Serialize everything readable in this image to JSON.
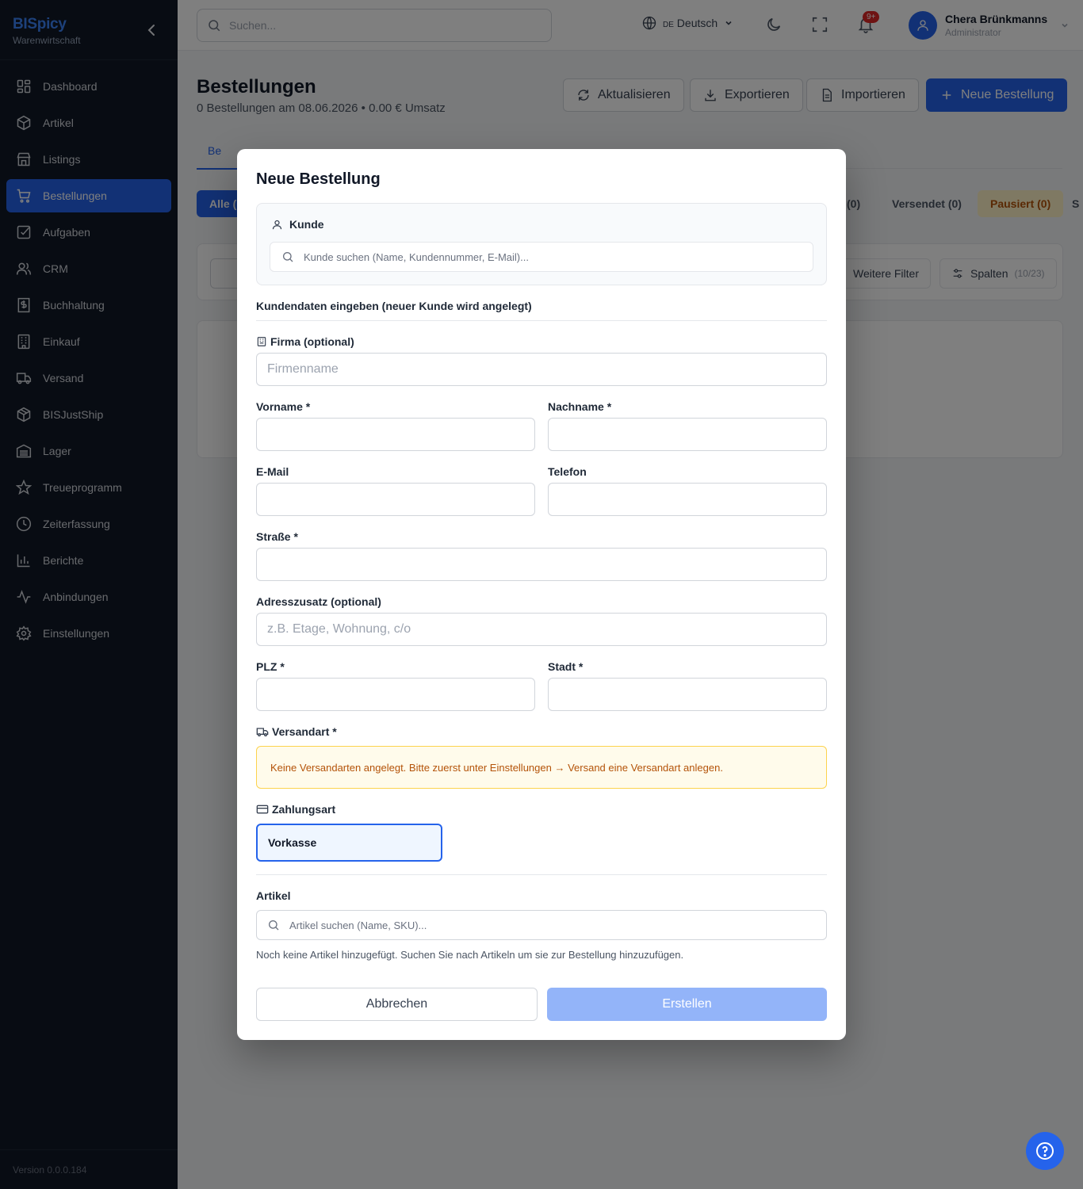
{
  "app": {
    "name": "BISpicy",
    "subtitle": "Warenwirtschaft",
    "version": "Version 0.0.0.184"
  },
  "sidebar": {
    "items": [
      {
        "label": "Dashboard",
        "icon": "grid-icon"
      },
      {
        "label": "Artikel",
        "icon": "box-icon"
      },
      {
        "label": "Listings",
        "icon": "store-icon"
      },
      {
        "label": "Bestellungen",
        "icon": "cart-icon",
        "active": true
      },
      {
        "label": "Aufgaben",
        "icon": "checkbox-icon"
      },
      {
        "label": "CRM",
        "icon": "users-icon"
      },
      {
        "label": "Buchhaltung",
        "icon": "receipt-icon"
      },
      {
        "label": "Einkauf",
        "icon": "building-icon"
      },
      {
        "label": "Versand",
        "icon": "truck-icon"
      },
      {
        "label": "BISJustShip",
        "icon": "package-icon"
      },
      {
        "label": "Lager",
        "icon": "warehouse-icon"
      },
      {
        "label": "Treueprogramm",
        "icon": "star-icon"
      },
      {
        "label": "Zeiterfassung",
        "icon": "clock-icon"
      },
      {
        "label": "Berichte",
        "icon": "chart-icon"
      },
      {
        "label": "Anbindungen",
        "icon": "activity-icon"
      },
      {
        "label": "Einstellungen",
        "icon": "gear-icon"
      }
    ]
  },
  "header": {
    "search_placeholder": "Suchen...",
    "lang_code": "DE",
    "lang_label": "Deutsch",
    "notif_badge": "9+",
    "user_name": "Chera Brünkmanns",
    "user_role": "Administrator"
  },
  "page": {
    "title": "Bestellungen",
    "subtitle": "0 Bestellungen am 08.06.2026 • 0.00 € Umsatz",
    "buttons": {
      "refresh": "Aktualisieren",
      "export": "Exportieren",
      "import": "Importieren",
      "new": "Neue Bestellung"
    },
    "tab_active": "Be",
    "chips": {
      "all": "Alle (",
      "c1": "(0)",
      "shipped": "Versendet (0)",
      "paused": "Pausiert (0)",
      "cut": "S"
    },
    "filters": {
      "more": "Weitere Filter",
      "columns": "Spalten",
      "columns_count": "(10/23)"
    }
  },
  "modal": {
    "title": "Neue Bestellung",
    "customer_label": "Kunde",
    "customer_search_placeholder": "Kunde suchen (Name, Kundennummer, E-Mail)...",
    "new_customer_heading": "Kundendaten eingeben (neuer Kunde wird angelegt)",
    "company_label": "Firma (optional)",
    "company_placeholder": "Firmenname",
    "firstname_label": "Vorname *",
    "lastname_label": "Nachname *",
    "email_label": "E-Mail",
    "phone_label": "Telefon",
    "street_label": "Straße *",
    "address_extra_label": "Adresszusatz (optional)",
    "address_extra_placeholder": "z.B. Etage, Wohnung, c/o",
    "zip_label": "PLZ *",
    "city_label": "Stadt *",
    "shipping_label": "Versandart *",
    "shipping_warning": "Keine Versandarten angelegt. Bitte zuerst unter Einstellungen → Versand eine Versandart anlegen.",
    "payment_label": "Zahlungsart",
    "payment_option": "Vorkasse",
    "articles_label": "Artikel",
    "articles_search_placeholder": "Artikel suchen (Name, SKU)...",
    "articles_empty": "Noch keine Artikel hinzugefügt. Suchen Sie nach Artikeln um sie zur Bestellung hinzuzufügen.",
    "cancel": "Abbrechen",
    "create": "Erstellen"
  },
  "colors": {
    "primary": "#2563eb",
    "sidebar_bg": "#111827",
    "warning_bg": "#fffbeb",
    "warning_text": "#b45309",
    "create_disabled": "#93b4f9"
  }
}
